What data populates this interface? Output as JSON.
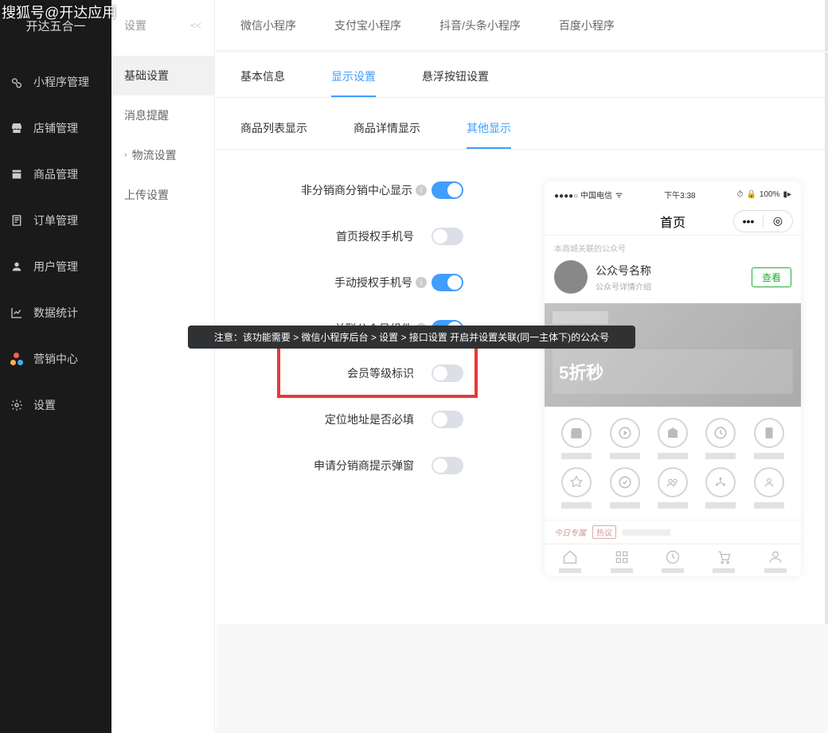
{
  "watermark": "搜狐号@开达应用",
  "sidebar_logo": "开达五合一",
  "sidebar": [
    {
      "label": "小程序管理"
    },
    {
      "label": "店铺管理"
    },
    {
      "label": "商品管理"
    },
    {
      "label": "订单管理"
    },
    {
      "label": "用户管理"
    },
    {
      "label": "数据统计"
    },
    {
      "label": "营销中心"
    },
    {
      "label": "设置"
    }
  ],
  "subsidebar": {
    "title": "设置",
    "collapse": "<<",
    "items": [
      {
        "label": "基础设置",
        "expandable": false
      },
      {
        "label": "消息提醒",
        "expandable": false
      },
      {
        "label": "物流设置",
        "expandable": true
      },
      {
        "label": "上传设置",
        "expandable": false
      }
    ]
  },
  "platform_tabs": [
    "微信小程序",
    "支付宝小程序",
    "抖音/头条小程序",
    "百度小程序"
  ],
  "main_tabs": [
    "基本信息",
    "显示设置",
    "悬浮按钮设置"
  ],
  "sub_tabs": [
    "商品列表显示",
    "商品详情显示",
    "其他显示"
  ],
  "settings": [
    {
      "label": "非分销商分销中心显示",
      "info": true,
      "on": true
    },
    {
      "label": "首页授权手机号",
      "info": false,
      "on": false
    },
    {
      "label": "手动授权手机号",
      "info": true,
      "on": true
    },
    {
      "label": "关联公众号组件",
      "info": true,
      "on": true
    },
    {
      "label": "会员等级标识",
      "info": false,
      "on": false
    },
    {
      "label": "定位地址是否必填",
      "info": false,
      "on": false
    },
    {
      "label": "申请分销商提示弹窗",
      "info": false,
      "on": false
    }
  ],
  "tooltip": "注意：该功能需要 > 微信小程序后台 > 设置 > 接口设置 开启并设置关联(同一主体下)的公众号",
  "preview": {
    "carrier": "●●●●○ 中国电信",
    "wifi": "ᯤ",
    "time": "下午3:38",
    "battery": "100%",
    "nav_title": "首页",
    "capsule_more": "•••",
    "capsule_close": "◎",
    "linked_tip": "本商城关联的公众号",
    "account_name": "公众号名称",
    "account_sub": "公众号详情介绍",
    "view_btn": "查看",
    "promo": "5折秒",
    "ribbon1": "今日专属",
    "ribbon2": "热议"
  }
}
